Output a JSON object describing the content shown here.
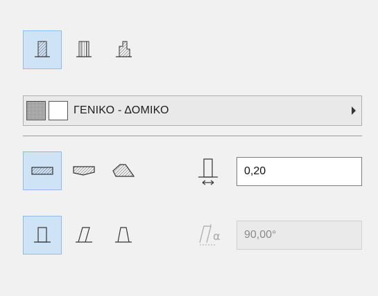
{
  "structure_type": {
    "options": [
      {
        "icon": "wall-single-slab-icon",
        "selected": true
      },
      {
        "icon": "wall-double-slab-icon",
        "selected": false
      },
      {
        "icon": "wall-stepped-slab-icon",
        "selected": false
      }
    ]
  },
  "material": {
    "label": "ΓΕΝΙΚΟ - ΔΟΜΙΚΟ",
    "swatches": [
      "#b7b7b7",
      "#ffffff"
    ]
  },
  "profile_type": {
    "options": [
      {
        "icon": "profile-rectangle-icon",
        "selected": true
      },
      {
        "icon": "profile-trapezoid-icon",
        "selected": false
      },
      {
        "icon": "profile-polygon-icon",
        "selected": false
      }
    ]
  },
  "thickness": {
    "icon": "wall-thickness-icon",
    "value": "0,20"
  },
  "geometry_type": {
    "options": [
      {
        "icon": "geometry-straight-icon",
        "selected": true
      },
      {
        "icon": "geometry-slanted-icon",
        "selected": false
      },
      {
        "icon": "geometry-trapezoid-icon",
        "selected": false
      }
    ]
  },
  "slant_angle": {
    "icon": "slant-angle-icon",
    "value": "90,00°",
    "enabled": false
  },
  "colors": {
    "selected_bg": "#cfe3f7",
    "selected_border": "#8fb9e6",
    "panel_bg": "#f1f1f1"
  }
}
